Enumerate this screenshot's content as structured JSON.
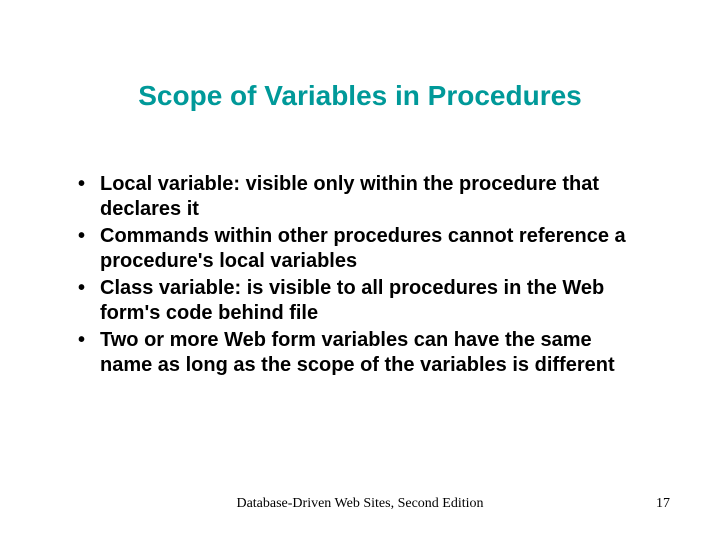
{
  "title": "Scope of Variables in Procedures",
  "bullets": [
    "Local variable: visible only within the procedure that declares it",
    "Commands within other procedures cannot reference a procedure's local variables",
    "Class variable: is visible to all procedures in the Web form's code behind file",
    "Two or more Web form variables can have the same name as long as the scope of the variables is different"
  ],
  "footer": {
    "text": "Database-Driven Web Sites, Second Edition",
    "page": "17"
  }
}
